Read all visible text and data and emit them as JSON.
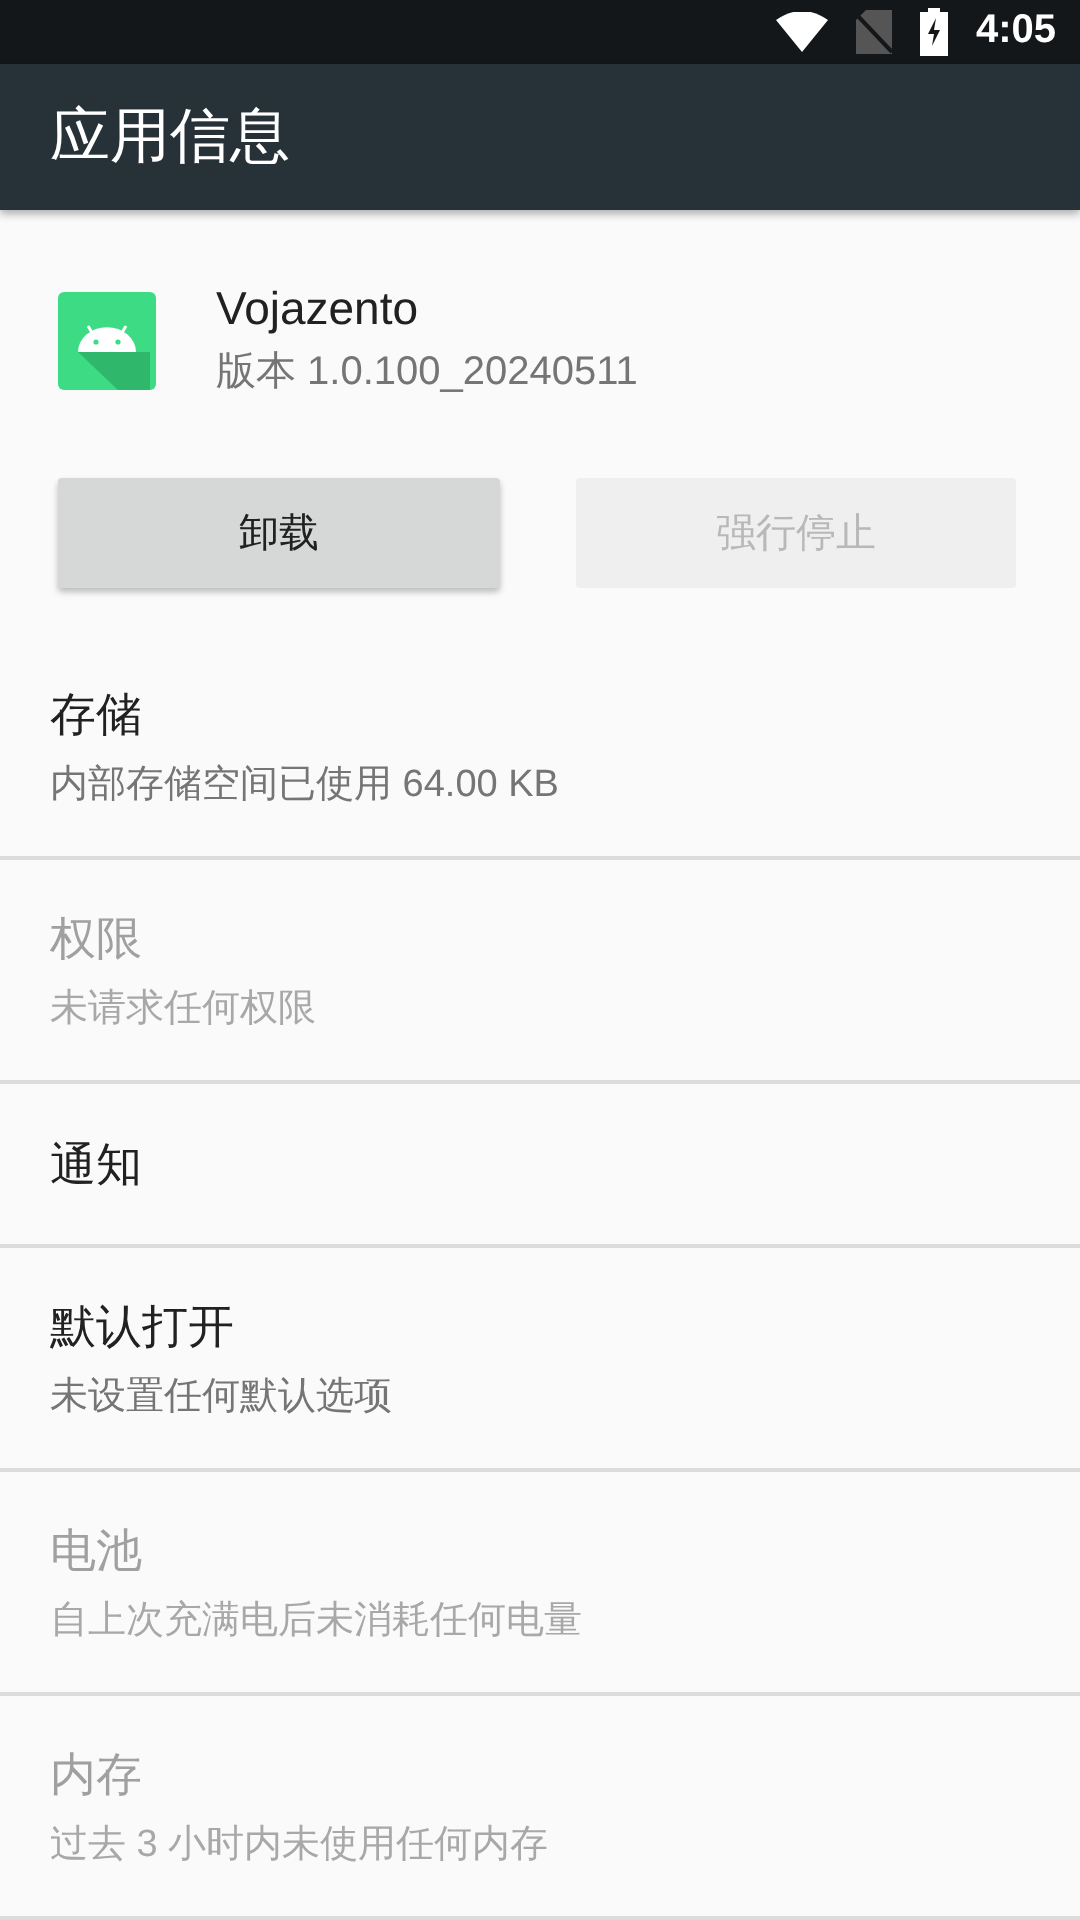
{
  "status_bar": {
    "time": "4:05"
  },
  "app_bar": {
    "title": "应用信息"
  },
  "app": {
    "name": "Vojazento",
    "version": "版本 1.0.100_20240511"
  },
  "buttons": [
    {
      "label": "卸载",
      "disabled": false
    },
    {
      "label": "强行停止",
      "disabled": true
    }
  ],
  "items": [
    {
      "title": "存储",
      "subtitle": "内部存储空间已使用 64.00 KB",
      "disabled": false
    },
    {
      "title": "权限",
      "subtitle": "未请求任何权限",
      "disabled": true
    },
    {
      "title": "通知",
      "disabled": false
    },
    {
      "title": "默认打开",
      "subtitle": "未设置任何默认选项",
      "disabled": false
    },
    {
      "title": "电池",
      "subtitle": "自上次充满电后未消耗任何电量",
      "disabled": true
    },
    {
      "title": "内存",
      "subtitle": "过去 3 小时内未使用任何内存",
      "disabled": true
    }
  ]
}
